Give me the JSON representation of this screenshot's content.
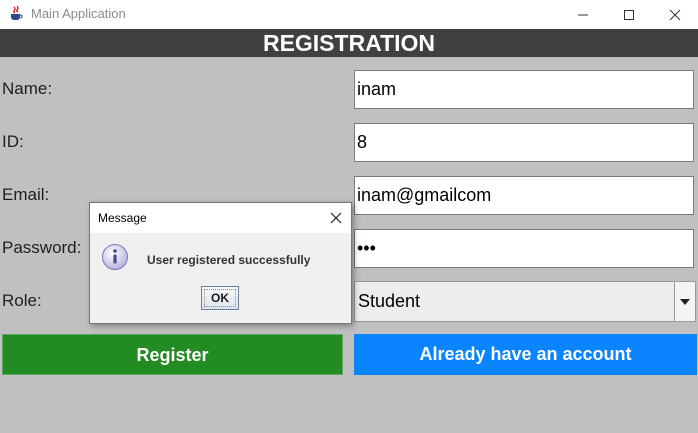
{
  "window": {
    "title": "Main Application"
  },
  "header": {
    "title": "REGISTRATION"
  },
  "form": {
    "name_label": "Name:",
    "name_value": "inam",
    "id_label": "ID:",
    "id_value": "8",
    "email_label": "Email:",
    "email_value": "inam@gmailcom",
    "password_label": "Password:",
    "password_value": "•••",
    "role_label": "Role:",
    "role_value": "Student"
  },
  "buttons": {
    "register": "Register",
    "login": "Already have an account"
  },
  "dialog": {
    "title": "Message",
    "message": "User registered successfully",
    "ok": "OK"
  },
  "colors": {
    "header_bg": "#404040",
    "register_bg": "#228b22",
    "login_bg": "#0a84ff",
    "background": "#c0c0c0"
  },
  "icons": {
    "app": "java-cup-icon",
    "minimize": "minimize-icon",
    "maximize": "maximize-icon",
    "close": "close-icon",
    "info": "info-icon",
    "dropdown": "chevron-down-icon"
  }
}
